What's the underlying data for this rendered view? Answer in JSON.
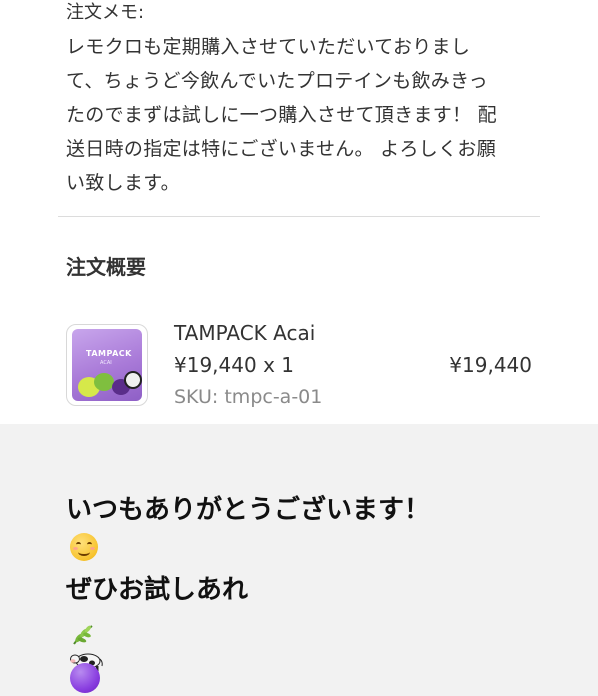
{
  "order": {
    "memo_label": "注文メモ:",
    "memo_lines": [
      "レモクロも定期購入させていただいておりまし",
      "て、ちょうど今飲んでいたプロテインも飲みきっ",
      "たのでまずは試しに一つ購入させて頂きます！ 配",
      "送日時の指定は特にございません。 よろしくお願",
      "い致します。"
    ],
    "summary_title": "注文概要",
    "item": {
      "name": "TAMPACK Acai",
      "price_qty": "¥19,440 x 1",
      "sku": "SKU: tmpc-a-01",
      "line_total": "¥19,440",
      "image_brand_text": "TAMPACK",
      "image_sub_text": "ACAI"
    }
  },
  "caption": {
    "line1": "いつもありがとうございます！",
    "line2": "ぜひお試しあれ",
    "emojis": [
      "smiling-face-icon",
      "herb-icon",
      "cow-icon",
      "purple-circle-icon"
    ]
  },
  "colors": {
    "background": "#f2f2f2",
    "card": "#ffffff",
    "text": "#333333",
    "muted": "#8a8a8a",
    "product_purple": "#a97ad8"
  }
}
